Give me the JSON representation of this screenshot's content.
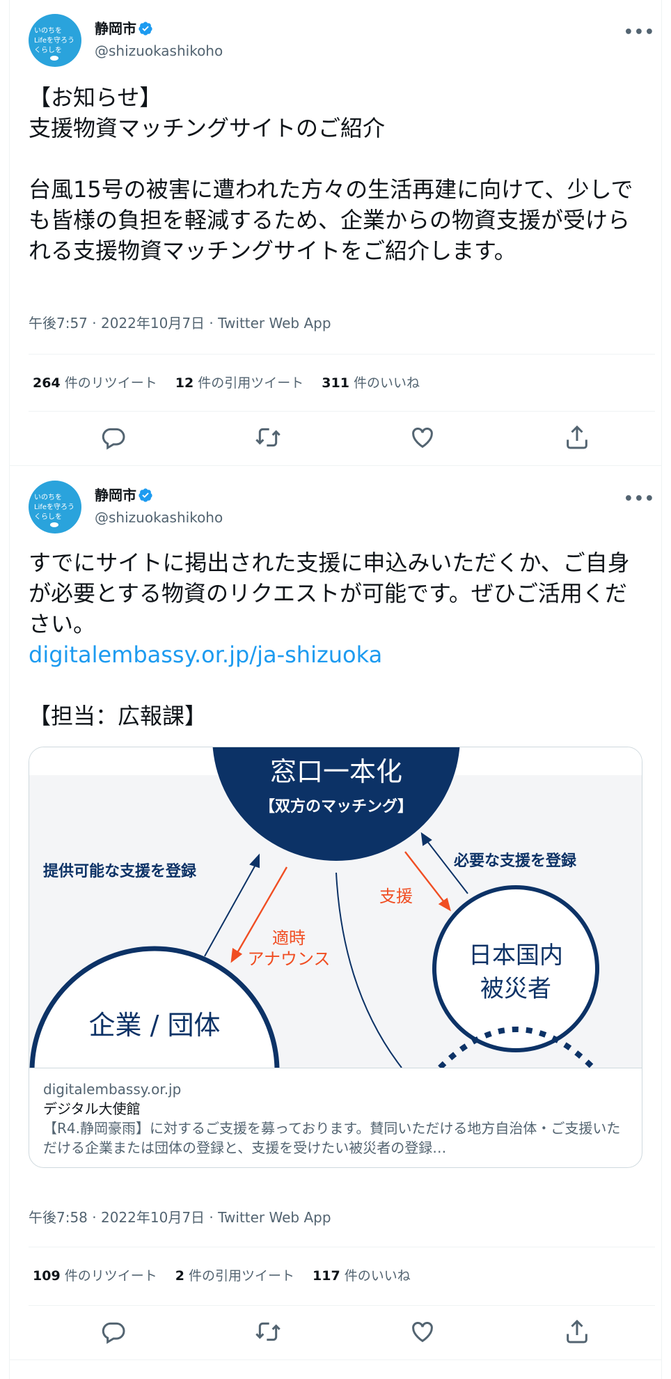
{
  "tweets": [
    {
      "author": {
        "name": "静岡市",
        "handle": "@shizuokashikoho",
        "avatar_lines": [
          "いのちを",
          "Lifeを守ろう",
          "くらしを"
        ]
      },
      "body": "【お知らせ】\n支援物資マッチングサイトのご紹介\n\n台風15号の被害に遭われた方々の生活再建に向けて、少しでも皆様の負担を軽減するため、企業からの物資支援が受けられる支援物資マッチングサイトをご紹介します。",
      "timestamp": "午後7:57 · 2022年10月7日 · Twitter Web App",
      "stats": {
        "retweets": "264",
        "retweets_label": "件のリツイート",
        "quotes": "12",
        "quotes_label": "件の引用ツイート",
        "likes": "311",
        "likes_label": "件のいいね"
      }
    },
    {
      "author": {
        "name": "静岡市",
        "handle": "@shizuokashikoho",
        "avatar_lines": [
          "いのちを",
          "Lifeを守ろう",
          "くらしを"
        ]
      },
      "body_before_link": "すでにサイトに掲出された支援に申込みいただくか、ご自身が必要とする物資のリクエストが可能です。ぜひご活用ください。\n",
      "link": "digitalembassy.or.jp/ja-shizuoka",
      "body_after_link": "\n\n【担当：広報課】",
      "card": {
        "image": {
          "center_top": "窓口一本化",
          "center_sub": "【双方のマッチング】",
          "left_arrow_label": "提供可能な支援を登録",
          "right_arrow_label": "必要な支援を登録",
          "support_label": "支援",
          "announce_label_1": "適時",
          "announce_label_2": "アナウンス",
          "right_circle_1": "日本国内",
          "right_circle_2": "被災者",
          "left_circle": "企業 / 団体"
        },
        "domain": "digitalembassy.or.jp",
        "title": "デジタル大使館",
        "description": "【R4.静岡豪雨】に対するご支援を募っております。賛同いただける地方自治体・ご支援いただける企業または団体の登録と、支援を受けたい被災者の登録…"
      },
      "timestamp": "午後7:58 · 2022年10月7日 · Twitter Web App",
      "stats": {
        "retweets": "109",
        "retweets_label": "件のリツイート",
        "quotes": "2",
        "quotes_label": "件の引用ツイート",
        "likes": "117",
        "likes_label": "件のいいね"
      }
    }
  ],
  "colors": {
    "link": "#1d9bf0",
    "navy": "#0c3266",
    "orange": "#f04e23",
    "avatar": "#2aa3dc"
  },
  "icons": [
    "verified-badge-icon",
    "more-icon",
    "reply-icon",
    "retweet-icon",
    "like-icon",
    "share-icon"
  ]
}
